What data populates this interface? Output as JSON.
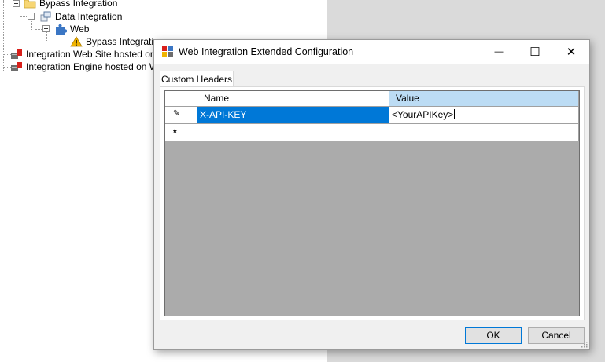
{
  "tree": {
    "items": [
      {
        "label": "Bypass Integration"
      },
      {
        "label": "Data Integration"
      },
      {
        "label": "Web"
      },
      {
        "label": "Bypass Integration"
      },
      {
        "label": "Integration Web Site hosted on WI"
      },
      {
        "label": "Integration Engine hosted on WIN-"
      }
    ]
  },
  "dialog": {
    "title": "Web Integration Extended Configuration",
    "window_buttons": {
      "minimize": "—",
      "maximize": "☐",
      "close": "✕"
    },
    "tab_label": "Custom Headers",
    "grid": {
      "columns": [
        "Name",
        "Value"
      ],
      "rows": [
        {
          "indicator": "✎",
          "name": "X-API-KEY",
          "value": "<YourAPIKey>"
        },
        {
          "indicator": "*",
          "name": "",
          "value": ""
        }
      ]
    },
    "ok_label": "OK",
    "cancel_label": "Cancel"
  },
  "colors": {
    "selection": "#0078d7",
    "column_header_active": "#bcdcf4",
    "grid_background": "#ababab"
  }
}
